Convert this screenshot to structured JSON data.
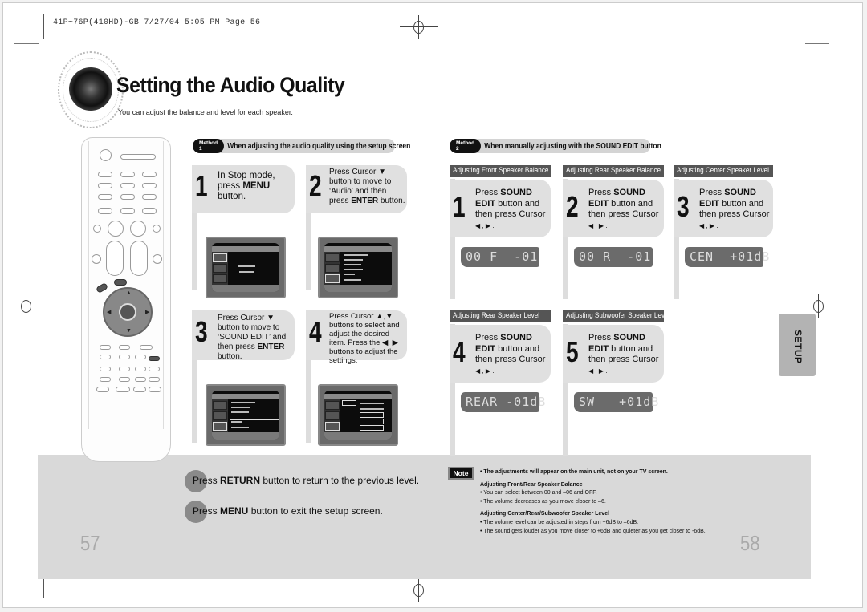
{
  "print_header": "41P~76P(410HD)-GB   7/27/04 5:05 PM   Page 56",
  "title": "Setting the Audio Quality",
  "subtitle": "You can adjust the balance and level for each speaker.",
  "side_tab": "SETUP",
  "method1": {
    "tag": "Method 1",
    "heading": "When adjusting the audio quality using the setup screen",
    "steps": [
      {
        "num": "1",
        "pre": "In Stop mode, press ",
        "bold": "MENU",
        "post": " button."
      },
      {
        "num": "2",
        "pre": "Press Cursor ▼ button to move to ‘Audio’ and then press ",
        "bold": "ENTER",
        "post": " button."
      },
      {
        "num": "3",
        "pre": "Press Cursor ▼ button to move to ‘SOUND EDIT’ and then press ",
        "bold": "ENTER",
        "post": " button."
      },
      {
        "num": "4",
        "pre": "Press Cursor ▲,▼ buttons to select and adjust the desired item. Press the ◀, ▶ buttons to adjust the settings.",
        "bold": "",
        "post": ""
      }
    ]
  },
  "method2": {
    "tag": "Method 2",
    "heading": "When manually adjusting with the SOUND EDIT button",
    "sections": [
      {
        "heading": "Adjusting Front Speaker Balance",
        "num": "1",
        "lcd": "00 F  -01"
      },
      {
        "heading": "Adjusting Rear Speaker Balance",
        "num": "2",
        "lcd": "00 R  -01"
      },
      {
        "heading": "Adjusting Center Speaker Level",
        "num": "3",
        "lcd": "CEN  +01dB"
      },
      {
        "heading": "Adjusting Rear Speaker Level",
        "num": "4",
        "lcd": "REAR -01dB"
      },
      {
        "heading": "Adjusting Subwoofer Speaker Level",
        "num": "5",
        "lcd": "SW   +01dB"
      }
    ],
    "step_text": {
      "pre": "Press ",
      "bold1": "SOUND",
      "bold2": "EDIT",
      "post1": " button and then press Cursor",
      "arrows": "◀ , ▶ ."
    }
  },
  "tips": [
    {
      "pre": "Press ",
      "bold": "RETURN",
      "post": " button to return to the previous level."
    },
    {
      "pre": "Press ",
      "bold": "MENU",
      "post": " button to exit the setup screen."
    }
  ],
  "note": {
    "tag": "Note",
    "main": "• The adjustments will appear on the main unit, not on your TV screen.",
    "groups": [
      {
        "heading": "Adjusting Front/Rear Speaker Balance",
        "items": [
          "• You can select between 00 and –06 and OFF.",
          "• The volume decreases as you move closer to –6."
        ]
      },
      {
        "heading": "Adjusting Center/Rear/Subwoofer Speaker Level",
        "items": [
          "• The volume level can be adjusted in steps from +6dB to –6dB.",
          "• The sound gets louder as you move closer to +6dB and quieter as you get closer to -6dB."
        ]
      }
    ]
  },
  "page_numbers": {
    "left": "57",
    "right": "58"
  }
}
